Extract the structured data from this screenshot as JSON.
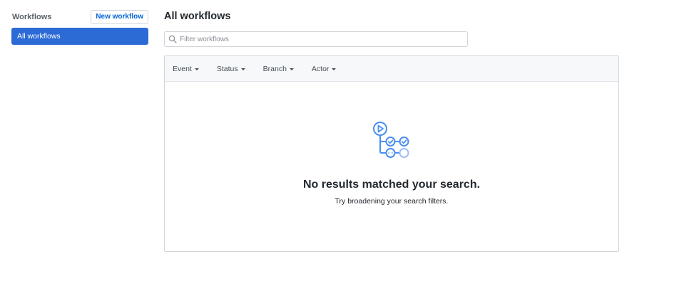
{
  "sidebar": {
    "title": "Workflows",
    "new_workflow_label": "New workflow",
    "items": [
      {
        "label": "All workflows",
        "selected": true
      }
    ]
  },
  "main": {
    "title": "All workflows",
    "search": {
      "placeholder": "Filter workflows",
      "value": "",
      "icon": "search-icon"
    },
    "filters": [
      {
        "label": "Event"
      },
      {
        "label": "Status"
      },
      {
        "label": "Branch"
      },
      {
        "label": "Actor"
      }
    ],
    "empty_state": {
      "icon": "workflow-graph-icon",
      "title": "No results matched your search.",
      "description": "Try broadening your search filters."
    }
  },
  "colors": {
    "accent": "#2c6bd6",
    "link": "#0366d6",
    "icon_blue": "#4a8ef0",
    "border": "#d1d5da",
    "filter_bar_bg": "#f6f8fa"
  }
}
